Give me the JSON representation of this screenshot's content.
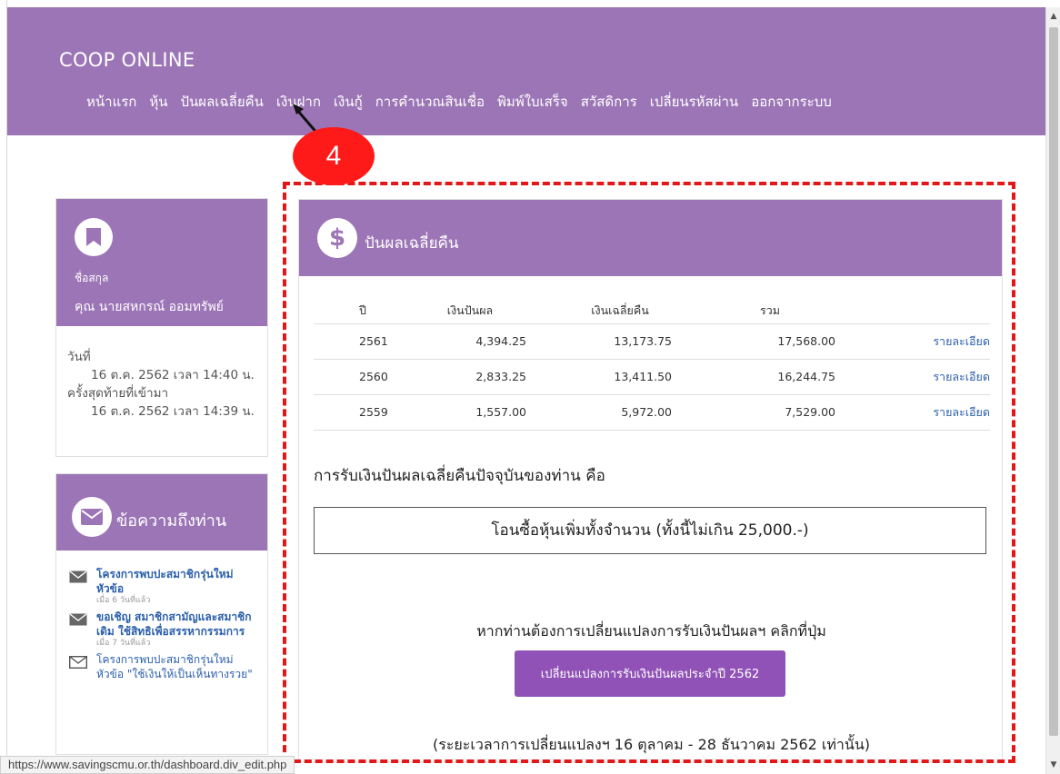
{
  "header": {
    "brand": "COOP ONLINE",
    "nav": [
      "หน้าแรก",
      "หุ้น",
      "ปันผลเฉลี่ยคืน",
      "เงินฝาก",
      "เงินกู้",
      "การคำนวณสินเชื่อ",
      "พิมพ์ใบเสร็จ",
      "สวัสดิการ",
      "เปลี่ยนรหัสผ่าน",
      "ออกจากระบบ"
    ]
  },
  "annotation": {
    "badge": "4",
    "color": "#ff1a1a"
  },
  "profile": {
    "surname_label": "ชื่อสกุล",
    "name": "คุณ นายสหกรณ์ ออมทรัพย์",
    "date_label": "วันที่",
    "date_value": "16 ต.ค. 2562 เวลา 14:40 น.",
    "last_login_label": "ครั้งสุดท้ายที่เข้ามา",
    "last_login_value": "16 ต.ค. 2562 เวลา 14:39 น."
  },
  "messages": {
    "title": "ข้อความถึงท่าน",
    "items": [
      {
        "title": "โครงการพบปะสมาชิกรุ่นใหม่ หัวข้อ",
        "time": "เมื่อ 6 วันที่แล้ว",
        "read": false
      },
      {
        "title": "ขอเชิญ สมาชิกสามัญและสมาชิกเดิม ใช้สิทธิเพื่อสรรหากรรมการ",
        "time": "เมื่อ 7 วันที่แล้ว",
        "read": false
      },
      {
        "title": "โครงการพบปะสมาชิกรุ่นใหม่ หัวข้อ \"ใช้เงินให้เป็นเห็นทางรวย\"",
        "time": "",
        "read": true
      }
    ]
  },
  "dividend": {
    "title": "ปันผลเฉลี่ยคืน",
    "icon_symbol": "$",
    "columns": [
      "ปี",
      "เงินปันผล",
      "เงินเฉลี่ยคืน",
      "รวม",
      ""
    ],
    "rows": [
      {
        "year": "2561",
        "dividend": "4,394.25",
        "refund": "13,173.75",
        "total": "17,568.00",
        "link": "รายละเอียด"
      },
      {
        "year": "2560",
        "dividend": "2,833.25",
        "refund": "13,411.50",
        "total": "16,244.75",
        "link": "รายละเอียด"
      },
      {
        "year": "2559",
        "dividend": "1,557.00",
        "refund": "5,972.00",
        "total": "7,529.00",
        "link": "รายละเอียด"
      }
    ],
    "receive_heading": "การรับเงินปันผลเฉลี่ยคืนปัจจุบันของท่าน คือ",
    "receive_method": "โอนซื้อหุ้นเพิ่มทั้งจำนวน (ทั้งนี้ไม่เกิน 25,000.-)",
    "change_note": "หากท่านต้องการเปลี่ยนแปลงการรับเงินปันผลฯ คลิกที่ปุ่ม",
    "change_button": "เปลี่ยนแปลงการรับเงินปันผลประจำปี 2562",
    "period": "(ระยะเวลาการเปลี่ยนแปลงฯ 16 ตุลาคม - 28 ธันวาคม 2562 เท่านั้น)"
  },
  "statusbar": {
    "url": "https://www.savingscmu.or.th/dashboard.div_edit.php"
  }
}
